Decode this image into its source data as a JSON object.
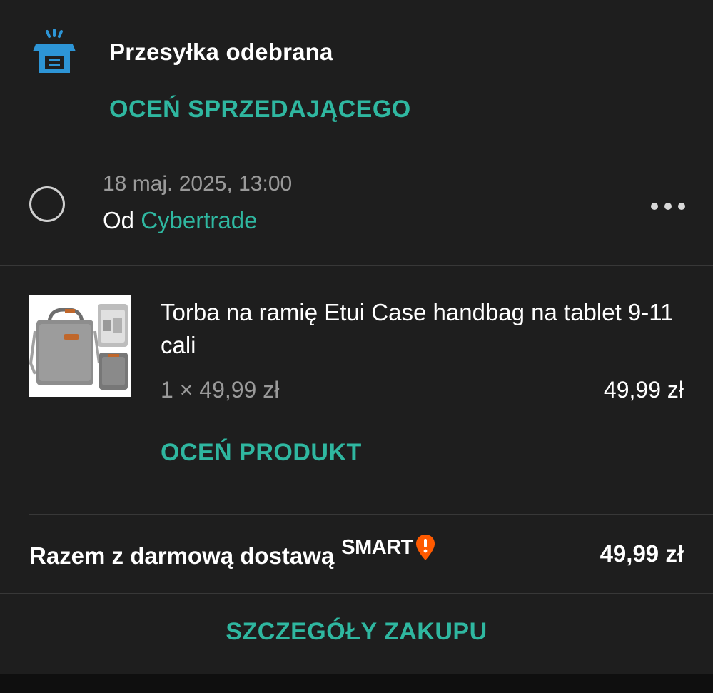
{
  "header": {
    "icon": "package-received-icon",
    "status_title": "Przesyłka odebrana",
    "rate_seller_label": "OCEŃ SPRZEDAJĄCEGO"
  },
  "order": {
    "date": "18 maj. 2025, 13:00",
    "seller_prefix": "Od",
    "seller_name": "Cybertrade",
    "more_icon": "more-horizontal-icon"
  },
  "product": {
    "name": "Torba na ramię Etui Case handbag na tablet 9-11 cali",
    "quantity_price": "1 × 49,99 zł",
    "line_total": "49,99 zł",
    "rate_product_label": "OCEŃ PRODUKT"
  },
  "total": {
    "label": "Razem z darmową dostawą",
    "smart_label": "SMART",
    "smart_icon": "smart-exclamation-pin-icon",
    "value": "49,99 zł"
  },
  "footer": {
    "details_label": "SZCZEGÓŁY ZAKUPU"
  },
  "colors": {
    "background": "#1e1e1e",
    "accent": "#2fb7a0",
    "icon_blue": "#2d95d6",
    "smart_orange": "#ff5a00"
  }
}
